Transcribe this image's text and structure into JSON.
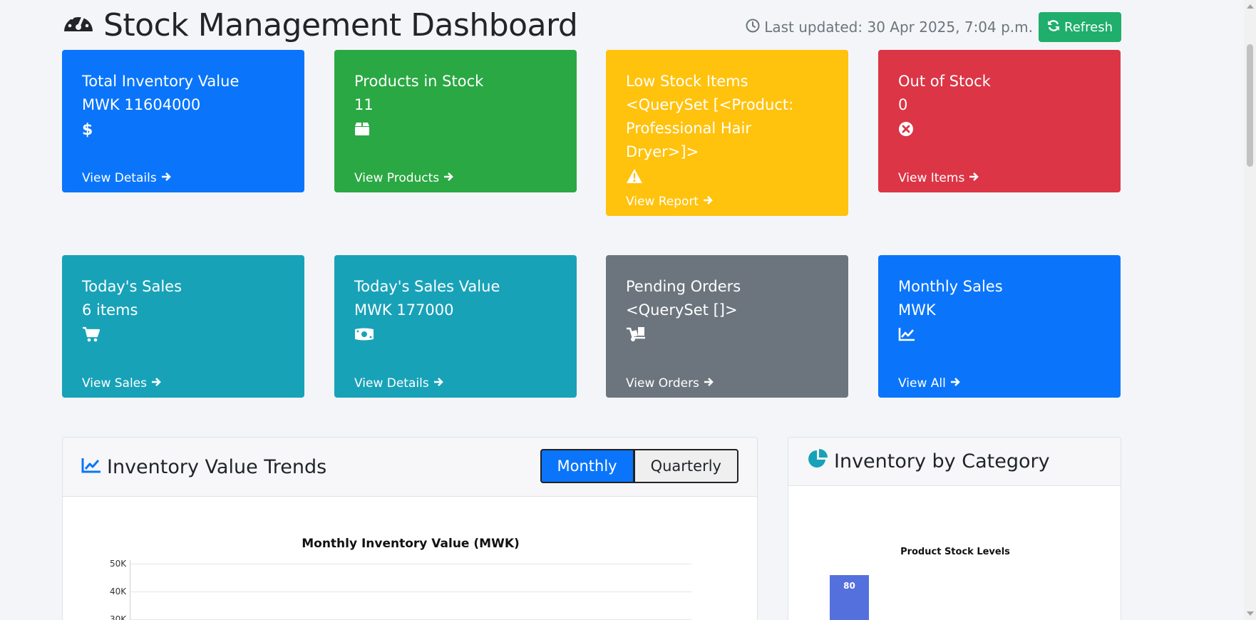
{
  "header": {
    "title": "Stock Management Dashboard",
    "last_updated": "Last updated: 30 Apr 2025, 7:04 p.m.",
    "refresh_label": "Refresh"
  },
  "cards_row1": [
    {
      "title": "Total Inventory Value",
      "value": "MWK 11604000",
      "icon": "dollar-icon",
      "link": "View Details",
      "color": "#0a75fb"
    },
    {
      "title": "Products in Stock",
      "value": "11",
      "icon": "box-icon",
      "link": "View Products",
      "color": "#2aa843"
    },
    {
      "title": "Low Stock Items",
      "value": "<QuerySet [<Product: Professional Hair Dryer>]>",
      "icon": "warning-icon",
      "link": "View Report",
      "color": "#ffc20d"
    },
    {
      "title": "Out of Stock",
      "value": "0",
      "icon": "times-circle-icon",
      "link": "View Items",
      "color": "#dc3546"
    }
  ],
  "cards_row2": [
    {
      "title": "Today's Sales",
      "value": "6 items",
      "icon": "cart-icon",
      "link": "View Sales",
      "color": "#18a2b8"
    },
    {
      "title": "Today's Sales Value",
      "value": "MWK 177000",
      "icon": "money-icon",
      "link": "View Details",
      "color": "#18a2b8"
    },
    {
      "title": "Pending Orders",
      "value": "<QuerySet []>",
      "icon": "dolly-icon",
      "link": "View Orders",
      "color": "#6c757e"
    },
    {
      "title": "Monthly Sales",
      "value": "MWK",
      "icon": "chart-line-icon",
      "link": "View All",
      "color": "#0a75fb"
    }
  ],
  "trends_panel": {
    "title": "Inventory Value Trends",
    "toggle_monthly": "Monthly",
    "toggle_quarterly": "Quarterly"
  },
  "category_panel": {
    "title": "Inventory by Category"
  },
  "chart_data": [
    {
      "type": "line",
      "title": "Monthly Inventory Value (MWK)",
      "y_ticks": [
        "50K",
        "40K",
        "30K"
      ],
      "ylim": [
        30000,
        50000
      ],
      "grid": true
    },
    {
      "type": "bar",
      "title": "Product Stock Levels",
      "values": [
        80
      ],
      "data_labels": [
        "80"
      ],
      "colors": [
        "#5470dd"
      ]
    }
  ]
}
